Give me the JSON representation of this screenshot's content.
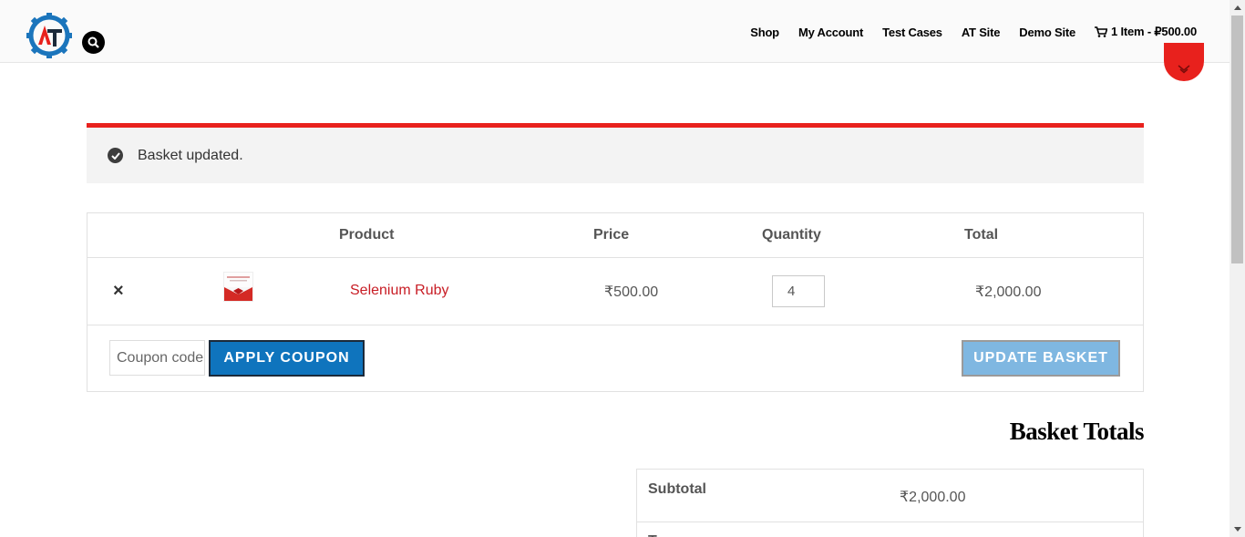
{
  "header": {
    "nav": [
      {
        "label": "Shop"
      },
      {
        "label": "My Account"
      },
      {
        "label": "Test Cases"
      },
      {
        "label": "AT Site"
      },
      {
        "label": "Demo Site"
      }
    ],
    "cart_link": "1 Item - ₽500.00"
  },
  "notice": {
    "message": "Basket updated."
  },
  "cart": {
    "headers": {
      "product": "Product",
      "price": "Price",
      "quantity": "Quantity",
      "total": "Total"
    },
    "items": [
      {
        "remove": "×",
        "name": "Selenium Ruby",
        "price": "₹500.00",
        "quantity": "4",
        "total": "₹2,000.00"
      }
    ],
    "coupon_placeholder": "Coupon code",
    "apply_label": "APPLY COUPON",
    "update_label": "UPDATE BASKET"
  },
  "totals": {
    "title": "Basket Totals",
    "subtotal_label": "Subtotal",
    "subtotal_value": "₹2,000.00",
    "next_label": "T"
  },
  "colors": {
    "accent": "#e8211d",
    "link": "#c81d25",
    "primary_button": "#0f74bd",
    "disabled_button": "#7fb7e1"
  }
}
